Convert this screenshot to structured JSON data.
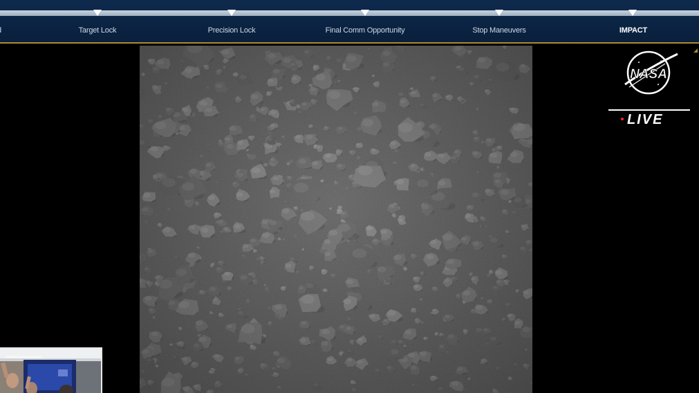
{
  "timeline": {
    "progress": 1.0,
    "milestones": [
      {
        "label": "d",
        "state": "done"
      },
      {
        "label": "Target Lock",
        "state": "done"
      },
      {
        "label": "Precision Lock",
        "state": "done"
      },
      {
        "label": "Final Comm Opportunity",
        "state": "done"
      },
      {
        "label": "Stop Maneuvers",
        "state": "done"
      },
      {
        "label": "IMPACT",
        "state": "active"
      }
    ],
    "colors": {
      "bar_bg": "#0b2444",
      "accent_border": "#b08a2e",
      "label": "#cfd9e4",
      "active_label": "#ffffff"
    }
  },
  "broadcast": {
    "logo": "nasa-meatball-logo",
    "logo_text": "NASA",
    "live_label": "LIVE",
    "live_dot_color": "#ff2a2a"
  },
  "feed": {
    "content": "asteroid-surface-camera-image"
  },
  "inset": {
    "content": "control-room-video"
  }
}
